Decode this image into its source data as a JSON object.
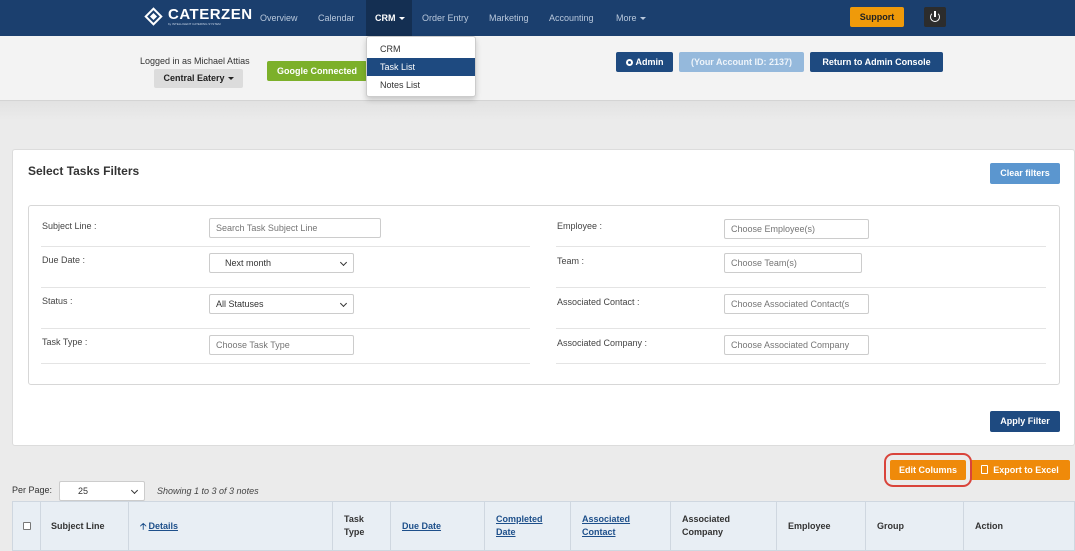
{
  "brand": {
    "name": "CATERZEN",
    "tagline": "by INTELLIGENT CATERING SYSTEM"
  },
  "nav": {
    "items": [
      {
        "label": "Overview"
      },
      {
        "label": "Calendar"
      },
      {
        "label": "CRM"
      },
      {
        "label": "Order Entry"
      },
      {
        "label": "Marketing"
      },
      {
        "label": "Accounting"
      },
      {
        "label": "More"
      }
    ],
    "active": "CRM",
    "support_label": "Support"
  },
  "crm_menu": {
    "items": [
      "CRM",
      "Task List",
      "Notes List"
    ],
    "selected": "Task List"
  },
  "account": {
    "logged_in": "Logged in as Michael Attias",
    "location": "Central Eatery",
    "google": "Google Connected",
    "admin": "Admin",
    "account_id": "(Your Account ID: 2137)",
    "return": "Return to Admin Console"
  },
  "filters": {
    "title": "Select Tasks Filters",
    "clear_label": "Clear filters",
    "apply_label": "Apply Filter",
    "subject_label": "Subject Line :",
    "subject_placeholder": "Search Task Subject Line",
    "due_label": "Due Date :",
    "due_value": "Next month",
    "status_label": "Status :",
    "status_value": "All Statuses",
    "type_label": "Task Type :",
    "type_placeholder": "Choose Task Type",
    "employee_label": "Employee :",
    "employee_placeholder": "Choose Employee(s)",
    "team_label": "Team :",
    "team_placeholder": "Choose Team(s)",
    "contact_label": "Associated Contact :",
    "contact_placeholder": "Choose Associated Contact(s",
    "company_label": "Associated Company :",
    "company_placeholder": "Choose Associated Company"
  },
  "list": {
    "edit_columns": "Edit Columns",
    "export": "Export to Excel",
    "per_page_label": "Per Page:",
    "per_page_value": "25",
    "showing": "Showing 1 to 3 of 3 notes"
  },
  "table": {
    "columns": [
      {
        "label": "Subject Line"
      },
      {
        "label": "Details"
      },
      {
        "label": "Task\nType"
      },
      {
        "label": "Due Date"
      },
      {
        "label": "Completed\nDate"
      },
      {
        "label": "Associated\nContact"
      },
      {
        "label": "Associated\nCompany"
      },
      {
        "label": "Employee"
      },
      {
        "label": "Group"
      },
      {
        "label": "Action"
      }
    ]
  },
  "colors": {
    "nav_bg": "#1b3f6e",
    "primary": "#1e4a80",
    "orange": "#ef8a0a",
    "google_green": "#7cb02a",
    "highlight": "#d9443b"
  }
}
